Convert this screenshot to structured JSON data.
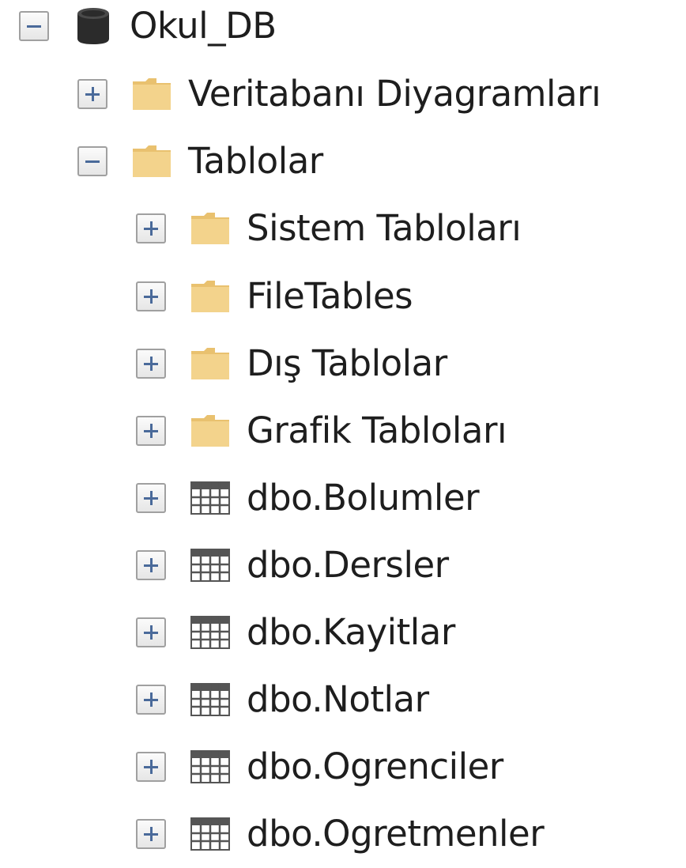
{
  "tree": {
    "root": {
      "label": "Okul_DB",
      "icon": "database-icon",
      "expanded": true
    },
    "diagrams": {
      "label": "Veritabanı Diyagramları",
      "icon": "folder-icon",
      "expanded": false
    },
    "tables": {
      "label": "Tablolar",
      "icon": "folder-icon",
      "expanded": true
    },
    "table_items": [
      {
        "label": "Sistem Tabloları",
        "icon": "folder-icon",
        "expanded": false
      },
      {
        "label": "FileTables",
        "icon": "folder-icon",
        "expanded": false
      },
      {
        "label": "Dış Tablolar",
        "icon": "folder-icon",
        "expanded": false
      },
      {
        "label": "Grafik Tabloları",
        "icon": "folder-icon",
        "expanded": false
      },
      {
        "label": "dbo.Bolumler",
        "icon": "table-icon",
        "expanded": false
      },
      {
        "label": "dbo.Dersler",
        "icon": "table-icon",
        "expanded": false
      },
      {
        "label": "dbo.Kayitlar",
        "icon": "table-icon",
        "expanded": false
      },
      {
        "label": "dbo.Notlar",
        "icon": "table-icon",
        "expanded": false
      },
      {
        "label": "dbo.Ogrenciler",
        "icon": "table-icon",
        "expanded": false
      },
      {
        "label": "dbo.Ogretmenler",
        "icon": "table-icon",
        "expanded": false
      }
    ]
  },
  "colors": {
    "folder": "#f3d38c",
    "folder_tab": "#e9c16f",
    "database": "#2b2b2b",
    "table_icon": "#555555",
    "toggle_sign": "#4a6a9a",
    "text": "#1e1e1e"
  }
}
